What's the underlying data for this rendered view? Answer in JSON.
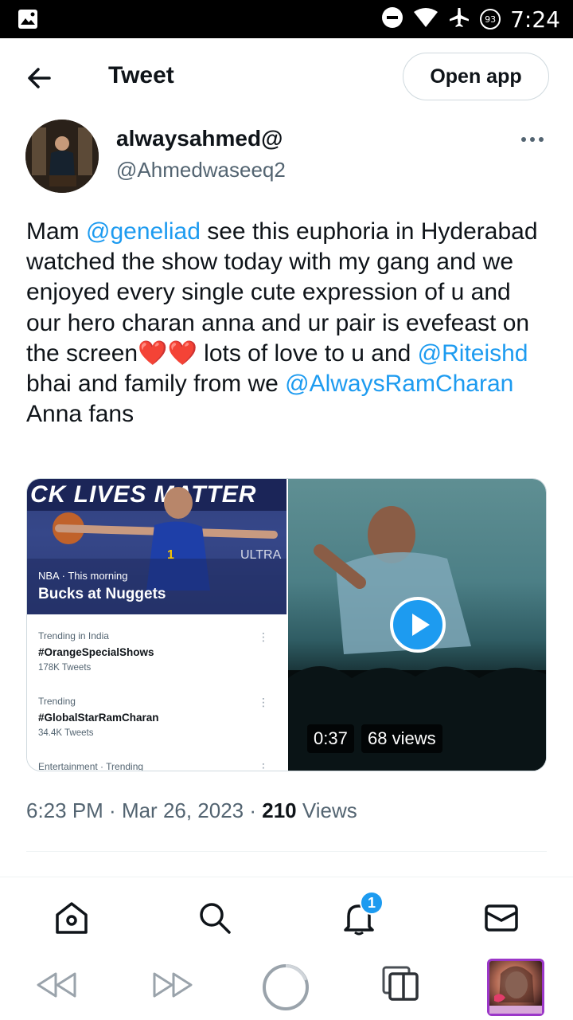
{
  "status_bar": {
    "time": "7:24",
    "battery": "93"
  },
  "header": {
    "title": "Tweet",
    "open_app_label": "Open app"
  },
  "author": {
    "display_name": "alwaysahmed@",
    "handle": "@Ahmedwaseeq2"
  },
  "tweet": {
    "segments": [
      {
        "text": "Mam ",
        "type": "text"
      },
      {
        "text": "@geneliad",
        "type": "mention"
      },
      {
        "text": " see this euphoria in Hyderabad watched the show today with my gang and we enjoyed every single cute expression of u and our hero charan anna and ur pair is evefeast on the screen",
        "type": "text"
      },
      {
        "text": "❤️❤️",
        "type": "emoji"
      },
      {
        "text": " lots of love to u and ",
        "type": "text"
      },
      {
        "text": "@Riteishd",
        "type": "mention"
      },
      {
        "text": " bhai and family from we ",
        "type": "text"
      },
      {
        "text": "@AlwaysRamCharan",
        "type": "mention"
      },
      {
        "text": " Anna fans",
        "type": "text"
      }
    ]
  },
  "media": {
    "image": {
      "banner_text": "CK LIVES MATTER",
      "meta": "NBA · This morning",
      "title": "Bucks at Nuggets",
      "trends": [
        {
          "category": "Trending in India",
          "name": "#OrangeSpecialShows",
          "count": "178K Tweets"
        },
        {
          "category": "Trending",
          "name": "#GlobalStarRamCharan",
          "count": "34.4K Tweets"
        },
        {
          "category": "Entertainment · Trending",
          "name": "",
          "count": ""
        }
      ]
    },
    "video": {
      "duration": "0:37",
      "views": "68 views"
    }
  },
  "meta": {
    "time": "6:23 PM",
    "date": "Mar 26, 2023",
    "views_count": "210",
    "views_label": "Views"
  },
  "tabbar": {
    "notification_badge": "1"
  }
}
